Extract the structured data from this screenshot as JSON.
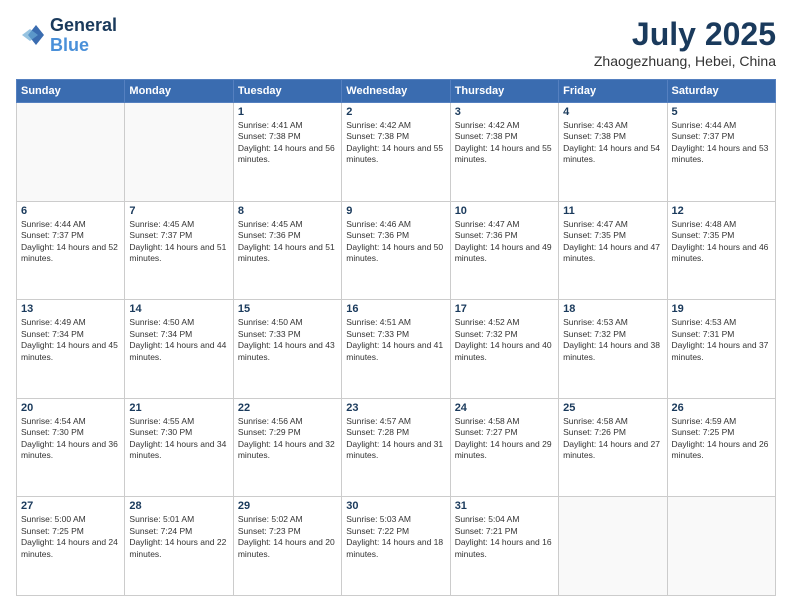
{
  "header": {
    "logo_line1": "General",
    "logo_line2": "Blue",
    "month": "July 2025",
    "location": "Zhaogezhuang, Hebei, China"
  },
  "weekdays": [
    "Sunday",
    "Monday",
    "Tuesday",
    "Wednesday",
    "Thursday",
    "Friday",
    "Saturday"
  ],
  "weeks": [
    [
      {
        "day": "",
        "info": ""
      },
      {
        "day": "",
        "info": ""
      },
      {
        "day": "1",
        "info": "Sunrise: 4:41 AM\nSunset: 7:38 PM\nDaylight: 14 hours and 56 minutes."
      },
      {
        "day": "2",
        "info": "Sunrise: 4:42 AM\nSunset: 7:38 PM\nDaylight: 14 hours and 55 minutes."
      },
      {
        "day": "3",
        "info": "Sunrise: 4:42 AM\nSunset: 7:38 PM\nDaylight: 14 hours and 55 minutes."
      },
      {
        "day": "4",
        "info": "Sunrise: 4:43 AM\nSunset: 7:38 PM\nDaylight: 14 hours and 54 minutes."
      },
      {
        "day": "5",
        "info": "Sunrise: 4:44 AM\nSunset: 7:37 PM\nDaylight: 14 hours and 53 minutes."
      }
    ],
    [
      {
        "day": "6",
        "info": "Sunrise: 4:44 AM\nSunset: 7:37 PM\nDaylight: 14 hours and 52 minutes."
      },
      {
        "day": "7",
        "info": "Sunrise: 4:45 AM\nSunset: 7:37 PM\nDaylight: 14 hours and 51 minutes."
      },
      {
        "day": "8",
        "info": "Sunrise: 4:45 AM\nSunset: 7:36 PM\nDaylight: 14 hours and 51 minutes."
      },
      {
        "day": "9",
        "info": "Sunrise: 4:46 AM\nSunset: 7:36 PM\nDaylight: 14 hours and 50 minutes."
      },
      {
        "day": "10",
        "info": "Sunrise: 4:47 AM\nSunset: 7:36 PM\nDaylight: 14 hours and 49 minutes."
      },
      {
        "day": "11",
        "info": "Sunrise: 4:47 AM\nSunset: 7:35 PM\nDaylight: 14 hours and 47 minutes."
      },
      {
        "day": "12",
        "info": "Sunrise: 4:48 AM\nSunset: 7:35 PM\nDaylight: 14 hours and 46 minutes."
      }
    ],
    [
      {
        "day": "13",
        "info": "Sunrise: 4:49 AM\nSunset: 7:34 PM\nDaylight: 14 hours and 45 minutes."
      },
      {
        "day": "14",
        "info": "Sunrise: 4:50 AM\nSunset: 7:34 PM\nDaylight: 14 hours and 44 minutes."
      },
      {
        "day": "15",
        "info": "Sunrise: 4:50 AM\nSunset: 7:33 PM\nDaylight: 14 hours and 43 minutes."
      },
      {
        "day": "16",
        "info": "Sunrise: 4:51 AM\nSunset: 7:33 PM\nDaylight: 14 hours and 41 minutes."
      },
      {
        "day": "17",
        "info": "Sunrise: 4:52 AM\nSunset: 7:32 PM\nDaylight: 14 hours and 40 minutes."
      },
      {
        "day": "18",
        "info": "Sunrise: 4:53 AM\nSunset: 7:32 PM\nDaylight: 14 hours and 38 minutes."
      },
      {
        "day": "19",
        "info": "Sunrise: 4:53 AM\nSunset: 7:31 PM\nDaylight: 14 hours and 37 minutes."
      }
    ],
    [
      {
        "day": "20",
        "info": "Sunrise: 4:54 AM\nSunset: 7:30 PM\nDaylight: 14 hours and 36 minutes."
      },
      {
        "day": "21",
        "info": "Sunrise: 4:55 AM\nSunset: 7:30 PM\nDaylight: 14 hours and 34 minutes."
      },
      {
        "day": "22",
        "info": "Sunrise: 4:56 AM\nSunset: 7:29 PM\nDaylight: 14 hours and 32 minutes."
      },
      {
        "day": "23",
        "info": "Sunrise: 4:57 AM\nSunset: 7:28 PM\nDaylight: 14 hours and 31 minutes."
      },
      {
        "day": "24",
        "info": "Sunrise: 4:58 AM\nSunset: 7:27 PM\nDaylight: 14 hours and 29 minutes."
      },
      {
        "day": "25",
        "info": "Sunrise: 4:58 AM\nSunset: 7:26 PM\nDaylight: 14 hours and 27 minutes."
      },
      {
        "day": "26",
        "info": "Sunrise: 4:59 AM\nSunset: 7:25 PM\nDaylight: 14 hours and 26 minutes."
      }
    ],
    [
      {
        "day": "27",
        "info": "Sunrise: 5:00 AM\nSunset: 7:25 PM\nDaylight: 14 hours and 24 minutes."
      },
      {
        "day": "28",
        "info": "Sunrise: 5:01 AM\nSunset: 7:24 PM\nDaylight: 14 hours and 22 minutes."
      },
      {
        "day": "29",
        "info": "Sunrise: 5:02 AM\nSunset: 7:23 PM\nDaylight: 14 hours and 20 minutes."
      },
      {
        "day": "30",
        "info": "Sunrise: 5:03 AM\nSunset: 7:22 PM\nDaylight: 14 hours and 18 minutes."
      },
      {
        "day": "31",
        "info": "Sunrise: 5:04 AM\nSunset: 7:21 PM\nDaylight: 14 hours and 16 minutes."
      },
      {
        "day": "",
        "info": ""
      },
      {
        "day": "",
        "info": ""
      }
    ]
  ]
}
